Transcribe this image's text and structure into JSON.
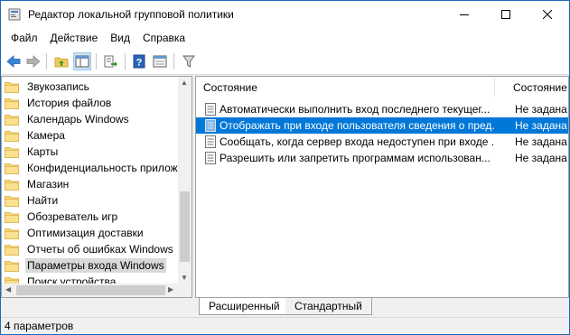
{
  "window": {
    "title": "Редактор локальной групповой политики"
  },
  "menu": [
    "Файл",
    "Действие",
    "Вид",
    "Справка"
  ],
  "toolbar": {
    "icons": [
      "back-arrow-icon",
      "forward-arrow-icon",
      "up-folder-icon",
      "show-hide-tree-icon",
      "export-list-icon",
      "help-icon",
      "properties-icon",
      "filter-icon"
    ]
  },
  "tree": {
    "items": [
      {
        "label": "Звукозапись",
        "selected": false
      },
      {
        "label": "История файлов",
        "selected": false
      },
      {
        "label": "Календарь Windows",
        "selected": false
      },
      {
        "label": "Камера",
        "selected": false
      },
      {
        "label": "Карты",
        "selected": false
      },
      {
        "label": "Конфиденциальность прилож",
        "selected": false
      },
      {
        "label": "Магазин",
        "selected": false
      },
      {
        "label": "Найти",
        "selected": false
      },
      {
        "label": "Обозреватель игр",
        "selected": false
      },
      {
        "label": "Оптимизация доставки",
        "selected": false
      },
      {
        "label": "Отчеты об ошибках Windows",
        "selected": false
      },
      {
        "label": "Параметры входа Windows",
        "selected": true
      },
      {
        "label": "Поиск устройства",
        "selected": false
      }
    ]
  },
  "list": {
    "columns": [
      "Состояние",
      "Состояние"
    ],
    "rows": [
      {
        "name": "Автоматически выполнить вход последнего текущег...",
        "state": "Не задана",
        "selected": false
      },
      {
        "name": "Отображать при входе пользователя сведения о пред...",
        "state": "Не задана",
        "selected": true
      },
      {
        "name": "Сообщать, когда сервер входа недоступен при входе ...",
        "state": "Не задана",
        "selected": false
      },
      {
        "name": "Разрешить или запретить программам использован...",
        "state": "Не задана",
        "selected": false
      }
    ]
  },
  "tabs": [
    "Расширенный",
    "Стандартный"
  ],
  "status": {
    "text": "4 параметров"
  },
  "colors": {
    "selection": "#0078d7",
    "window_border": "#1c6ab8",
    "folder": "#f8d775"
  }
}
